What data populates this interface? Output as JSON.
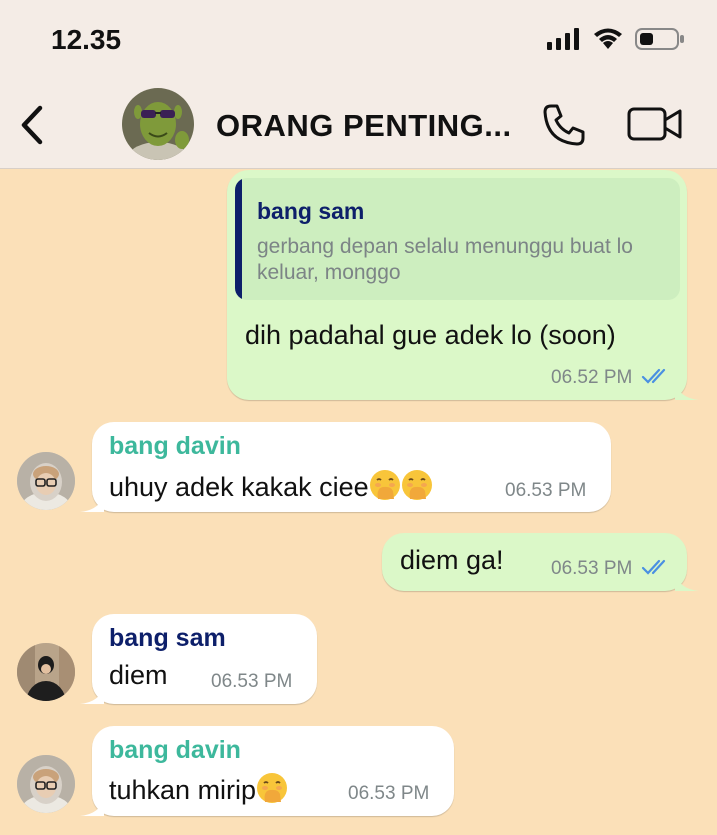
{
  "status": {
    "time": "12.35"
  },
  "header": {
    "title": "ORANG PENTING..."
  },
  "colors": {
    "chat_bg": "#fbe0b8",
    "outgoing_bubble": "#dbf8c8",
    "incoming_bubble": "#ffffff",
    "sender_sam": "#0d1f6a",
    "sender_davin": "#3db89c",
    "read_ticks": "#4a90e2"
  },
  "messages": [
    {
      "direction": "outgoing",
      "quote": {
        "sender": "bang sam",
        "text": "gerbang depan selalu menunggu buat lo keluar, monggo"
      },
      "text": "dih padahal gue adek lo (soon)",
      "time": "06.52 PM",
      "status_icon": "double-check-icon"
    },
    {
      "direction": "incoming",
      "sender": "bang davin",
      "text": "uhuy adek kakak ciee",
      "emojis": [
        "hand-over-mouth-emoji",
        "hand-over-mouth-emoji"
      ],
      "time": "06.53 PM"
    },
    {
      "direction": "outgoing",
      "text": "diem ga!",
      "time": "06.53 PM",
      "status_icon": "double-check-icon"
    },
    {
      "direction": "incoming",
      "sender": "bang sam",
      "text": "diem",
      "time": "06.53 PM"
    },
    {
      "direction": "incoming",
      "sender": "bang davin",
      "text": "tuhkan mirip",
      "emojis": [
        "hand-over-mouth-emoji"
      ],
      "time": "06.53 PM"
    }
  ]
}
